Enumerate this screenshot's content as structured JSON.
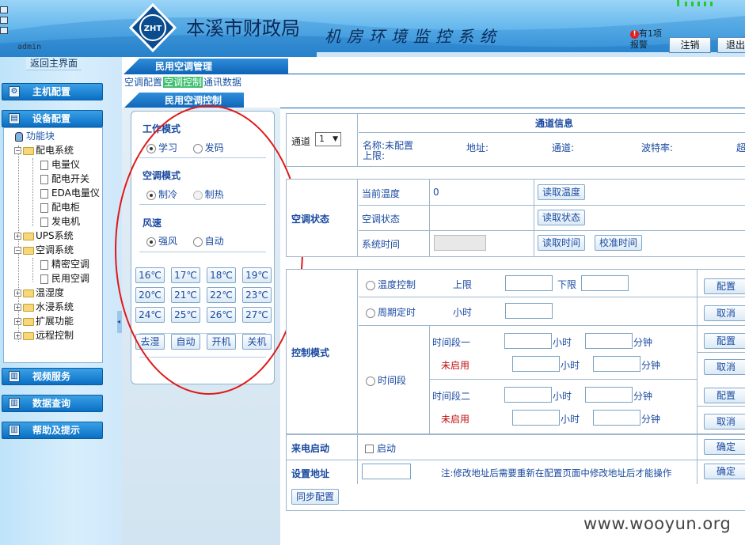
{
  "header": {
    "logo_text": "ZHT",
    "org_name": "本溪市财政局",
    "system_title": "机房环境监控系统",
    "user": "admin",
    "alarm_badge": "!",
    "alarm_text": "有1项报警",
    "logout_label": "注销",
    "exit_label": "退出"
  },
  "sidebar": {
    "back_main": "返回主界面",
    "host_config": "主机配置",
    "device_config": "设备配置",
    "video_service": "视频服务",
    "data_query": "数据查询",
    "help": "帮助及提示",
    "tree": {
      "root": "功能块",
      "power_system": "配电系统",
      "meter": "电量仪",
      "switch": "配电开关",
      "eda_meter": "EDA电量仪",
      "cabinet": "配电柜",
      "generator": "发电机",
      "ups": "UPS系统",
      "ac_system": "空调系统",
      "precision_ac": "精密空调",
      "civil_ac": "民用空调",
      "temp_humidity": "温湿度",
      "water": "水浸系统",
      "extension": "扩展功能",
      "remote": "远程控制"
    }
  },
  "main": {
    "section_title": "民用空调管理",
    "tabs": [
      "空调配置",
      "空调控制",
      "通讯数据"
    ],
    "active_tab": "空调控制",
    "sub_title": "民用空调控制"
  },
  "panel": {
    "work_mode_title": "工作模式",
    "work_mode_options": [
      "学习",
      "发码"
    ],
    "ac_mode_title": "空调模式",
    "ac_mode_options": [
      "制冷",
      "制热"
    ],
    "wind_title": "风速",
    "wind_options": [
      "强风",
      "自动"
    ],
    "temps": [
      "16℃",
      "17℃",
      "18℃",
      "19℃",
      "20℃",
      "21℃",
      "22℃",
      "23℃",
      "24℃",
      "25℃",
      "26℃",
      "27℃"
    ],
    "actions": [
      "去湿",
      "自动",
      "开机",
      "关机"
    ]
  },
  "channel": {
    "label": "通道",
    "value": "1",
    "info_title": "通道信息",
    "name_label": "名称:",
    "name_value": "未配置",
    "upper_line": "上限:",
    "address_label": "地址:",
    "channel_label": "通道:",
    "baud_label": "波特率:",
    "extra_label": "超"
  },
  "ac_status": {
    "title": "空调状态",
    "current_temp_label": "当前温度",
    "current_temp_value": "0",
    "read_temp_button": "读取温度",
    "status_label": "空调状态",
    "read_status_button": "读取状态",
    "time_label": "系统时间",
    "read_time_button": "读取时间",
    "calibrate_time_button": "校准时间"
  },
  "control": {
    "title": "控制模式",
    "temp_control": "温度控制",
    "upper": "上限",
    "lower": "下限",
    "periodic": "周期定时",
    "hours": "小时",
    "time_segment": "时间段",
    "segment1": "时间段一",
    "segment2": "时间段二",
    "minutes": "分钟",
    "disabled": "未启用",
    "config_button": "配置",
    "cancel_button": "取消"
  },
  "power_on": {
    "label": "来电启动",
    "checkbox_label": "启动",
    "confirm_button": "确定"
  },
  "set_address": {
    "label": "设置地址",
    "note": "注:修改地址后需要重新在配置页面中修改地址后才能操作",
    "confirm_button": "确定"
  },
  "sync_button": "同步配置",
  "watermark": "www.wooyun.org"
}
